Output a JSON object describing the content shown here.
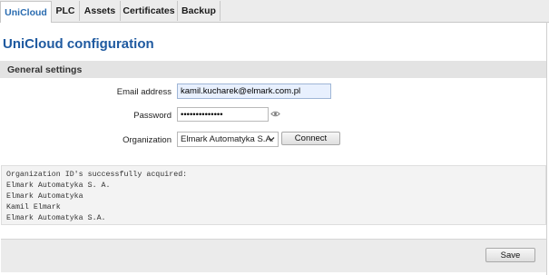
{
  "tabs": [
    {
      "label": "UniCloud",
      "active": true
    },
    {
      "label": "PLC",
      "active": false
    },
    {
      "label": "Assets",
      "active": false
    },
    {
      "label": "Certificates",
      "active": false
    },
    {
      "label": "Backup",
      "active": false
    }
  ],
  "page_title": "UniCloud configuration",
  "section_title": "General settings",
  "form": {
    "email_label": "Email address",
    "email_value": "kamil.kucharek@elmark.com.pl",
    "password_label": "Password",
    "password_value": "••••••••••••••",
    "organization_label": "Organization",
    "organization_value": "Elmark Automatyka S.A.",
    "connect_label": "Connect"
  },
  "log": {
    "lines": [
      "Organization ID's successfully acquired:",
      "Elmark Automatyka S. A.",
      "Elmark Automatyka",
      "Kamil Elmark",
      "Elmark Automatyka S.A."
    ]
  },
  "footer": {
    "save_label": "Save"
  },
  "colors": {
    "accent": "#1f5aa0",
    "active_tab_text": "#2a6cb0",
    "tabbar_bg": "#ececec",
    "section_bg": "#e3e3e3",
    "autofill_bg": "#e8f0fe"
  }
}
